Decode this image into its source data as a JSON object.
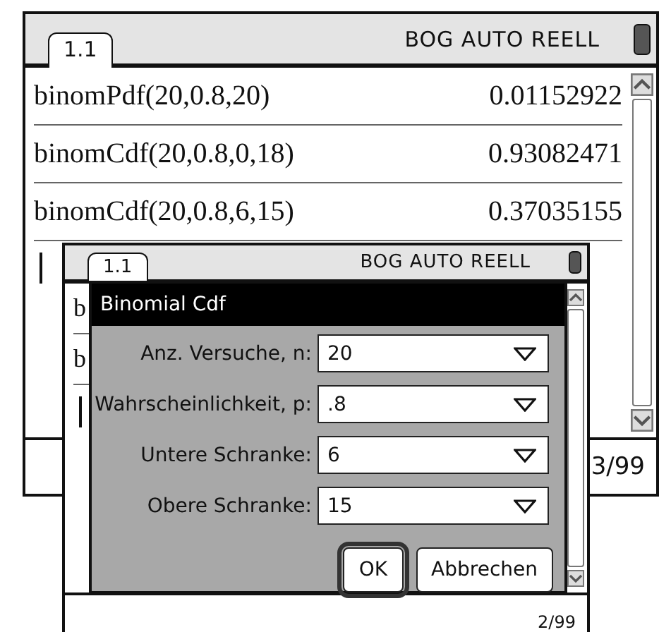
{
  "back_screen": {
    "tab": "1.1",
    "status": "BOG AUTO REELL",
    "rows": [
      {
        "expression": "binomPdf(20,0.8,20)",
        "result": "0.01152922"
      },
      {
        "expression": "binomCdf(20,0.8,0,18)",
        "result": "0.93082471"
      },
      {
        "expression": "binomCdf(20,0.8,6,15)",
        "result": "0.37035155"
      }
    ],
    "page_counter": "3/99"
  },
  "front_screen": {
    "tab": "1.1",
    "status": "BOG AUTO REELL",
    "rows": [
      {
        "expression": "b"
      },
      {
        "expression": "b"
      }
    ],
    "page_counter": "2/99"
  },
  "dialog": {
    "title": "Binomial Cdf",
    "fields": [
      {
        "label": "Anz. Versuche, n:",
        "value": "20"
      },
      {
        "label": "Wahrscheinlichkeit, p:",
        "value": ".8"
      },
      {
        "label": "Untere Schranke:",
        "value": "6"
      },
      {
        "label": "Obere Schranke:",
        "value": "15"
      }
    ],
    "buttons": [
      {
        "label": "OK",
        "selected": true
      },
      {
        "label": "Abbrechen",
        "selected": false
      }
    ]
  }
}
